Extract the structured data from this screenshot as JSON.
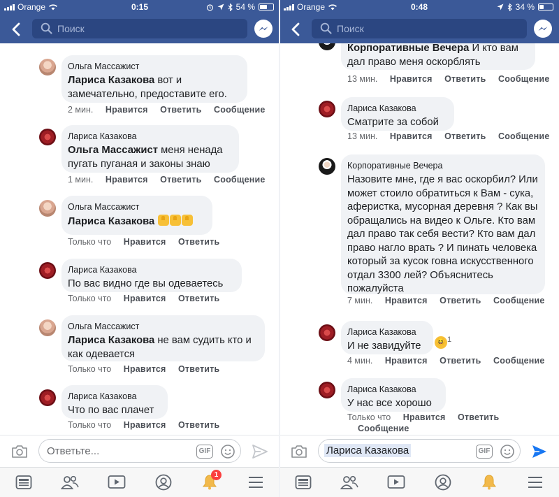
{
  "left": {
    "status": {
      "carrier": "Orange",
      "time": "0:15",
      "battery": "54 %",
      "battery_fill": 0.54
    },
    "search": {
      "placeholder": "Поиск"
    },
    "comments": [
      {
        "author": "Ольга Массажист",
        "avatar": "olga",
        "mention": "Лариса Казакова",
        "text": " вот и замечательно, предоставите его.",
        "time": "2 мин.",
        "actions": [
          "Нравится",
          "Ответить",
          "Сообщение"
        ]
      },
      {
        "author": "Лариса Казакова",
        "avatar": "larisa",
        "mention": "Ольга Массажист",
        "text": " меня ненада пугать пуганая и законы знаю",
        "time": "1 мин.",
        "actions": [
          "Нравится",
          "Ответить",
          "Сообщение"
        ]
      },
      {
        "author": "Ольга Массажист",
        "avatar": "olga",
        "mention": "Лариса Казакова",
        "text": "",
        "emoji": "three-thumbs-up",
        "time": "Только что",
        "actions": [
          "Нравится",
          "Ответить"
        ]
      },
      {
        "author": "Лариса Казакова",
        "avatar": "larisa",
        "mention": "",
        "text": "По вас видно где вы одеваетесь",
        "time": "Только что",
        "actions": [
          "Нравится",
          "Ответить"
        ]
      },
      {
        "author": "Ольга Массажист",
        "avatar": "olga",
        "mention": "Лариса Казакова",
        "text": " не вам судить  кто и как одевается",
        "time": "Только что",
        "actions": [
          "Нравится",
          "Ответить"
        ]
      },
      {
        "author": "Лариса Казакова",
        "avatar": "larisa",
        "mention": "",
        "text": "Что по вас плачет",
        "time": "Только что",
        "actions": [
          "Нравится",
          "Ответить"
        ]
      }
    ],
    "reply": {
      "placeholder": "Ответьте...",
      "gif_label": "GIF"
    },
    "tabs": {
      "notifications_badge": "1"
    }
  },
  "right": {
    "status": {
      "carrier": "Orange",
      "time": "0:48",
      "battery": "34 %",
      "battery_fill": 0.34
    },
    "search": {
      "placeholder": "Поиск"
    },
    "comments": [
      {
        "author": "",
        "avatar": "corp",
        "mention": "Корпоративные Вечера",
        "text": " И кто вам дал право меня оскорблять",
        "time": "13 мин.",
        "actions": [
          "Нравится",
          "Ответить",
          "Сообщение"
        ]
      },
      {
        "author": "Лариса Казакова",
        "avatar": "larisa",
        "mention": "",
        "text": "Сматрите за собой",
        "time": "13 мин.",
        "actions": [
          "Нравится",
          "Ответить",
          "Сообщение"
        ]
      },
      {
        "author": "Корпоративные Вечера",
        "avatar": "corp",
        "mention": "",
        "text": "Назовите мне, где я вас оскорбил? Или может стоило обратиться к Вам - сука, аферистка, мусорная деревня ? Как вы обращались на видео к Ольге. Кто вам дал право так себя вести? Кто вам дал право нагло врать ? И пинать человека который за кусок говна искусственного отдал 3300 лей? Объяснитесь пожалуйста",
        "time": "7 мин.",
        "actions": [
          "Нравится",
          "Ответить",
          "Сообщение"
        ]
      },
      {
        "author": "Лариса Казакова",
        "avatar": "larisa",
        "mention": "",
        "text": "И не завидуйте",
        "reaction": "laugh",
        "reaction_count": "1",
        "time": "4 мин.",
        "actions": [
          "Нравится",
          "Ответить",
          "Сообщение"
        ]
      },
      {
        "author": "Лариса Казакова",
        "avatar": "larisa",
        "mention": "",
        "text": "У нас все хорошо",
        "time": "Только что",
        "actions": [
          "Нравится",
          "Ответить"
        ],
        "actions_line2": "Сообщение"
      }
    ],
    "reply": {
      "mention": "Лариса Казакова",
      "gif_label": "GIF"
    }
  }
}
